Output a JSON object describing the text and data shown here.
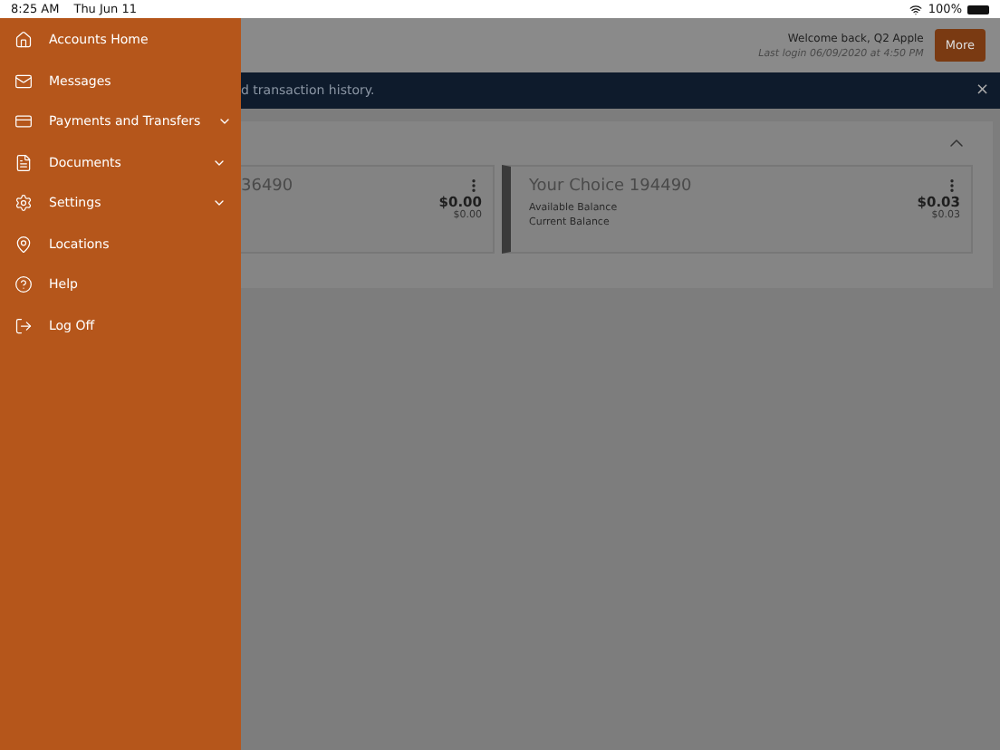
{
  "status_bar": {
    "time": "8:25 AM",
    "date": "Thu Jun 11",
    "battery": "100%"
  },
  "menu": [
    {
      "kind": "home",
      "label": "Accounts Home",
      "expandable": false
    },
    {
      "kind": "mail",
      "label": "Messages",
      "expandable": false
    },
    {
      "kind": "card",
      "label": "Payments and Transfers",
      "expandable": true
    },
    {
      "kind": "document",
      "label": "Documents",
      "expandable": true
    },
    {
      "kind": "settings",
      "label": "Settings",
      "expandable": true
    },
    {
      "kind": "location",
      "label": "Locations",
      "expandable": false
    },
    {
      "kind": "help",
      "label": "Help",
      "expandable": false
    },
    {
      "kind": "logout",
      "label": "Log Off",
      "expandable": false
    }
  ],
  "header": {
    "welcome": "Welcome back, Q2 Apple",
    "last_login": "Last login 06/09/2020 at 4:50 PM",
    "more_button": "More"
  },
  "banner": {
    "text": "d transaction history.",
    "close": "×"
  },
  "accounts": [
    {
      "name": "36490",
      "cut": true,
      "available": "$0.00",
      "current": "$0.00"
    },
    {
      "name": "Your Choice 194490",
      "cut": false,
      "available_label": "Available Balance",
      "current_label": "Current Balance",
      "available": "$0.03",
      "current": "$0.03"
    }
  ]
}
